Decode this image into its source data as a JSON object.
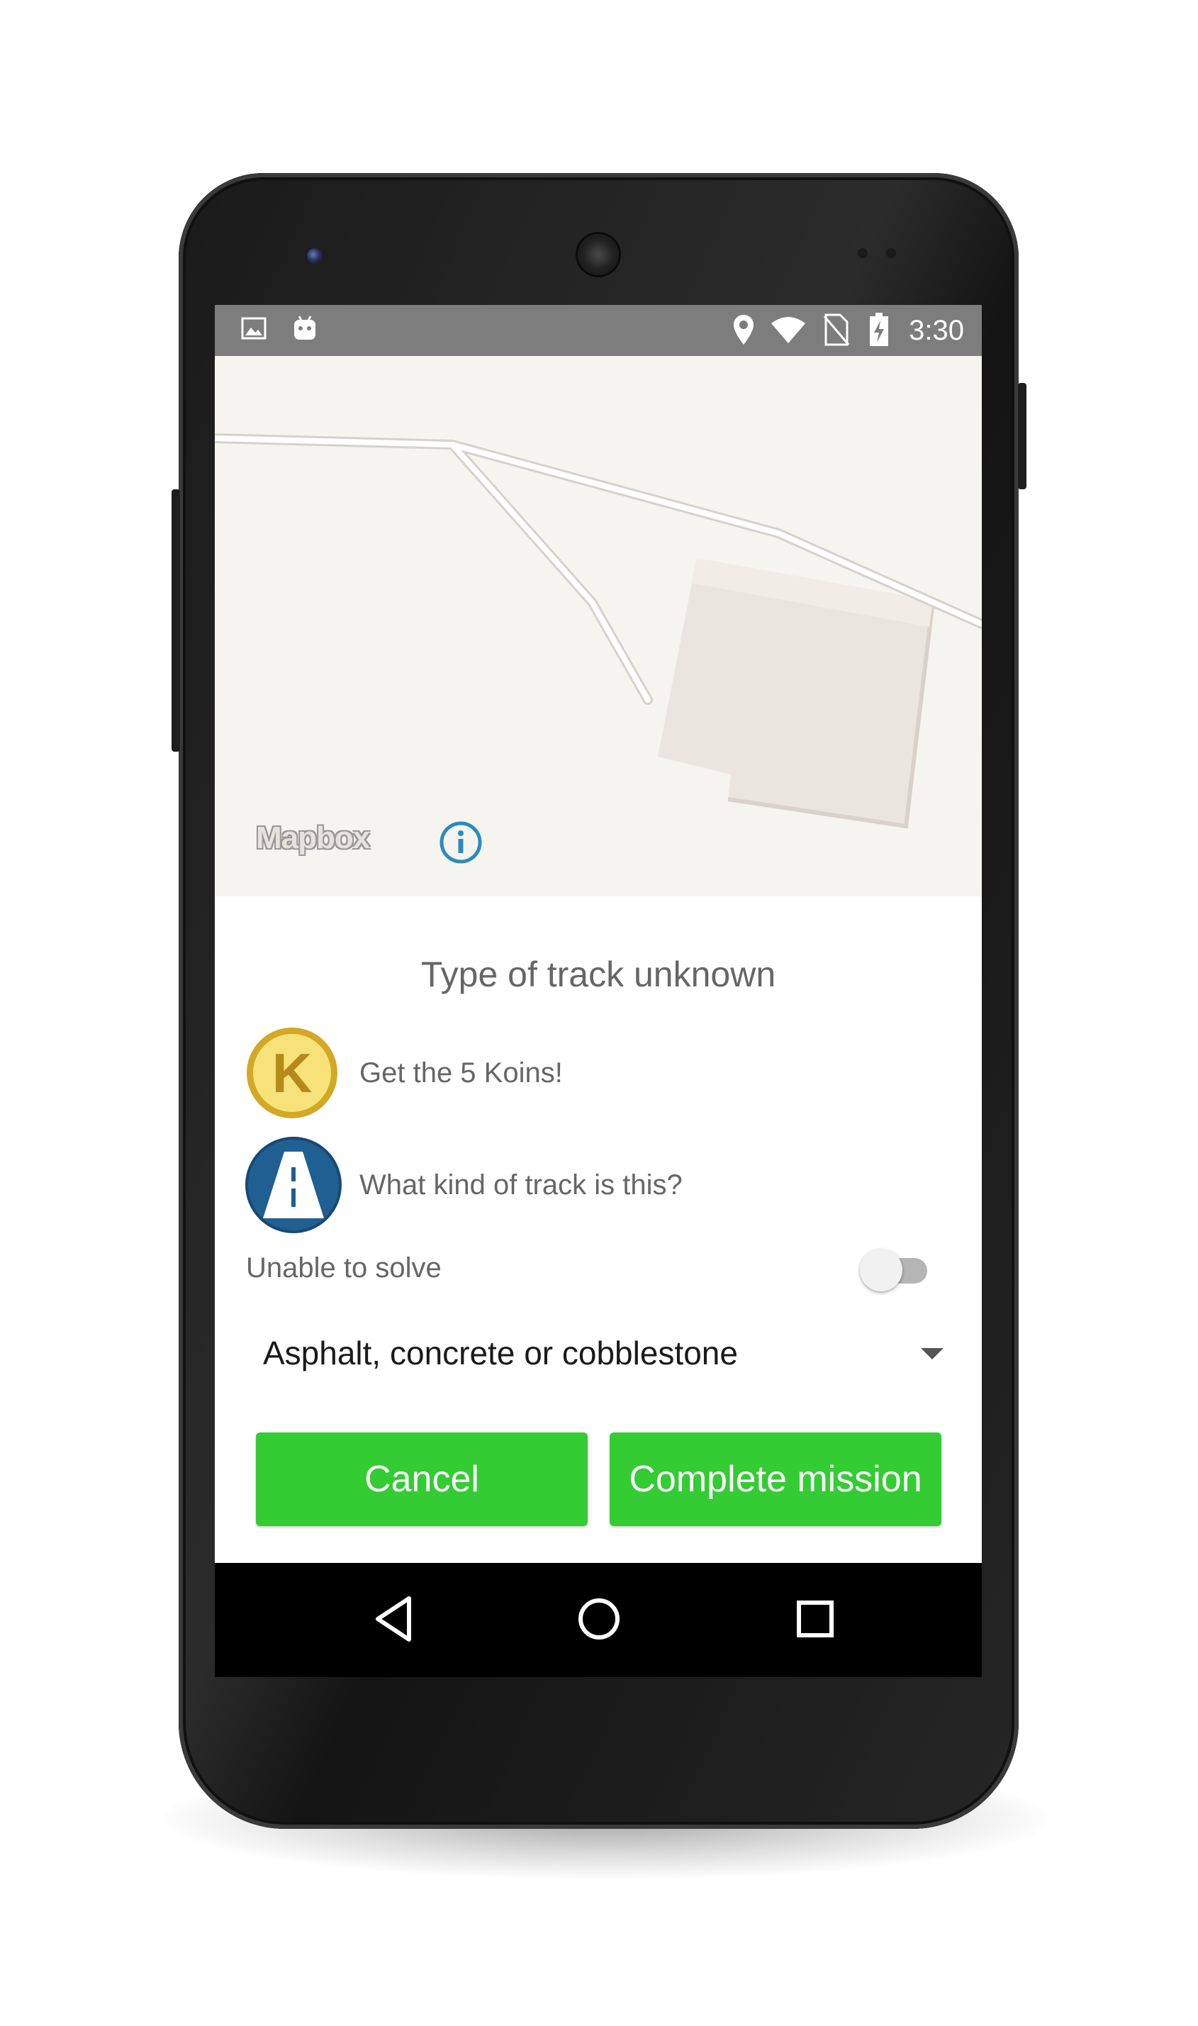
{
  "status_bar": {
    "time": "3:30",
    "left_icons": [
      "image-icon",
      "android-icon"
    ],
    "right_icons": [
      "location-icon",
      "wifi-icon",
      "no-sim-icon",
      "battery-charging-icon"
    ]
  },
  "map": {
    "attribution": "Mapbox",
    "info_icon": "info-icon"
  },
  "mission": {
    "title": "Type of track unknown",
    "reward_text": "Get the 5 Koins!",
    "coin_letter": "K",
    "question": "What kind of track is this?",
    "unable_label": "Unable to solve",
    "unable_toggle_on": false,
    "selected_option": "Asphalt, concrete or cobblestone",
    "cancel_label": "Cancel",
    "complete_label": "Complete mission"
  },
  "colors": {
    "accent_green": "#33cc33",
    "coin_gold": "#e8c23a",
    "road_blue": "#1f5f91",
    "map_bg": "#f6f4ef"
  },
  "nav_bar": [
    "back-icon",
    "home-icon",
    "recents-icon"
  ]
}
